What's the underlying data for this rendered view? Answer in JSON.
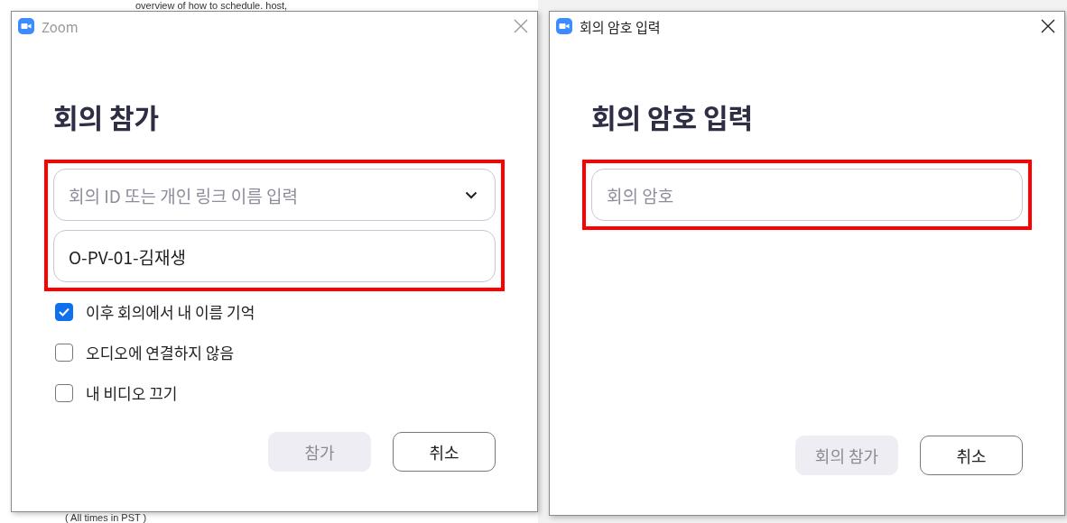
{
  "background_page": {
    "lines": [
      "overview of how to schedule. host,",
      "( All times in PST )"
    ]
  },
  "dialogs": [
    {
      "title": "Zoom",
      "active": false,
      "heading": "회의 참가",
      "fields": [
        {
          "kind": "dropdown",
          "placeholder": "회의 ID 또는 개인 링크 이름 입력"
        },
        {
          "kind": "text",
          "value": "O-PV-01-김재생"
        }
      ],
      "checkboxes": [
        {
          "label": "이후 회의에서 내 이름 기억",
          "checked": true
        },
        {
          "label": "오디오에 연결하지 않음",
          "checked": false
        },
        {
          "label": "내 비디오 끄기",
          "checked": false
        }
      ],
      "buttons": [
        {
          "label": "참가",
          "disabled": true
        },
        {
          "label": "취소",
          "disabled": false
        }
      ]
    },
    {
      "title": "회의 암호 입력",
      "active": true,
      "heading": "회의 암호 입력",
      "fields": [
        {
          "kind": "text",
          "placeholder": "회의 암호"
        }
      ],
      "buttons": [
        {
          "label": "회의 참가",
          "disabled": true
        },
        {
          "label": "취소",
          "disabled": false
        }
      ]
    }
  ]
}
